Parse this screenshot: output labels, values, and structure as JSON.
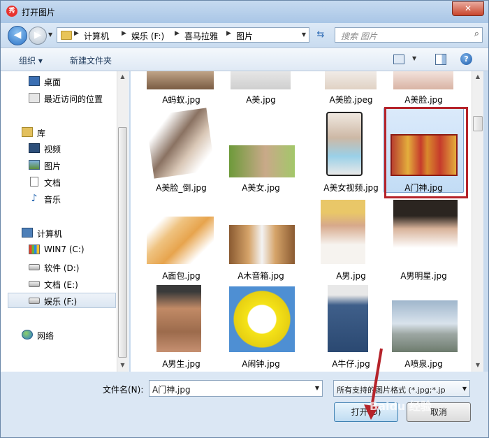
{
  "window": {
    "title": "打开图片",
    "app_icon": "秀",
    "close_label": "✕"
  },
  "nav_buttons": {
    "back": "◀",
    "forward": "▶"
  },
  "address": {
    "crumbs": [
      "计算机",
      "娱乐 (F:)",
      "喜马拉雅",
      "图片"
    ]
  },
  "search": {
    "placeholder": "搜索 图片"
  },
  "toolbar": {
    "organize": "组织 ▾",
    "new_folder": "新建文件夹",
    "help": "?"
  },
  "nav_pane": {
    "items": [
      {
        "label": "桌面",
        "icon": "desktop-icon"
      },
      {
        "label": "最近访问的位置",
        "icon": "recent-places-icon"
      },
      {
        "label": "库",
        "icon": "library-icon"
      },
      {
        "label": "视频",
        "icon": "video-icon"
      },
      {
        "label": "图片",
        "icon": "pictures-icon"
      },
      {
        "label": "文档",
        "icon": "documents-icon"
      },
      {
        "label": "音乐",
        "icon": "music-icon"
      },
      {
        "label": "计算机",
        "icon": "computer-icon"
      },
      {
        "label": "WIN7 (C:)",
        "icon": "windows-drive-icon"
      },
      {
        "label": "软件 (D:)",
        "icon": "drive-icon"
      },
      {
        "label": "文档 (E:)",
        "icon": "drive-icon"
      },
      {
        "label": "娱乐 (F:)",
        "icon": "drive-icon",
        "selected": true
      },
      {
        "label": "网络",
        "icon": "network-icon"
      }
    ]
  },
  "files": [
    {
      "name": "A蚂蚁.jpg"
    },
    {
      "name": "A美.jpg"
    },
    {
      "name": "A美脸.jpeg"
    },
    {
      "name": "A美脸.jpg"
    },
    {
      "name": "A美脸_倒.jpg"
    },
    {
      "name": "A美女.jpg"
    },
    {
      "name": "A美女视频.jpg"
    },
    {
      "name": "A门神.jpg",
      "selected": true
    },
    {
      "name": "A面包.jpg"
    },
    {
      "name": "A木音箱.jpg"
    },
    {
      "name": "A男.jpg"
    },
    {
      "name": "A男明星.jpg"
    },
    {
      "name": "A男生.jpg"
    },
    {
      "name": "A闹钟.jpg"
    },
    {
      "name": "A牛仔.jpg"
    },
    {
      "name": "A喷泉.jpg"
    }
  ],
  "bottom": {
    "filename_label": "文件名(N):",
    "filename_value": "A门神.jpg",
    "filter_value": "所有支持的图片格式 (*.jpg;*.jp",
    "open_label": "打开(O)",
    "cancel_label": "取消"
  },
  "watermark": "Baidu 经验",
  "colors": {
    "annotation_red": "#b5232a",
    "selection_blue": "#c2dcf5"
  }
}
